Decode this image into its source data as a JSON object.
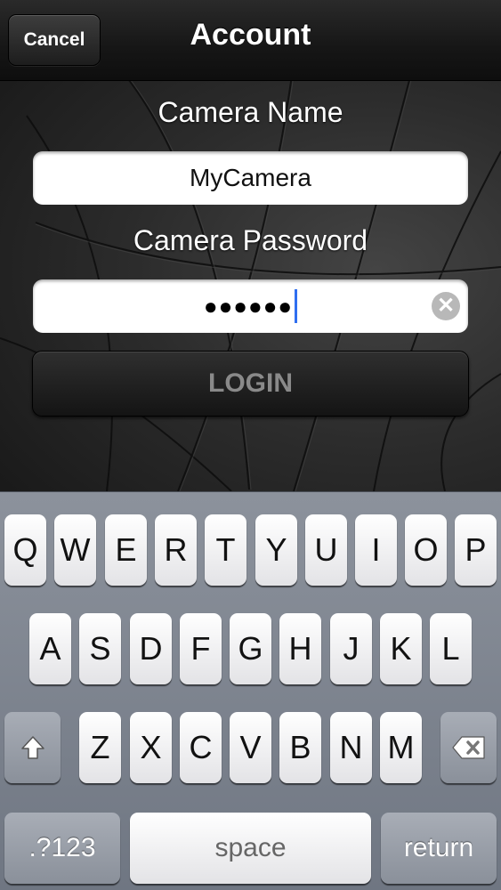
{
  "navbar": {
    "cancel_label": "Cancel",
    "title": "Account"
  },
  "form": {
    "camera_name_label": "Camera Name",
    "camera_name_value": "MyCamera",
    "camera_password_label": "Camera Password",
    "camera_password_masked": "●●●●●●",
    "clear_icon": "clear-icon",
    "login_label": "LOGIN"
  },
  "keyboard": {
    "row1": [
      "Q",
      "W",
      "E",
      "R",
      "T",
      "Y",
      "U",
      "I",
      "O",
      "P"
    ],
    "row2": [
      "A",
      "S",
      "D",
      "F",
      "G",
      "H",
      "J",
      "K",
      "L"
    ],
    "row3": [
      "Z",
      "X",
      "C",
      "V",
      "B",
      "N",
      "M"
    ],
    "shift_icon": "shift-icon",
    "backspace_icon": "backspace-icon",
    "numbers_label": ".?123",
    "space_label": "space",
    "return_label": "return"
  },
  "colors": {
    "cursor": "#2f6ef0",
    "keyboard_bg": "#7a808b"
  }
}
